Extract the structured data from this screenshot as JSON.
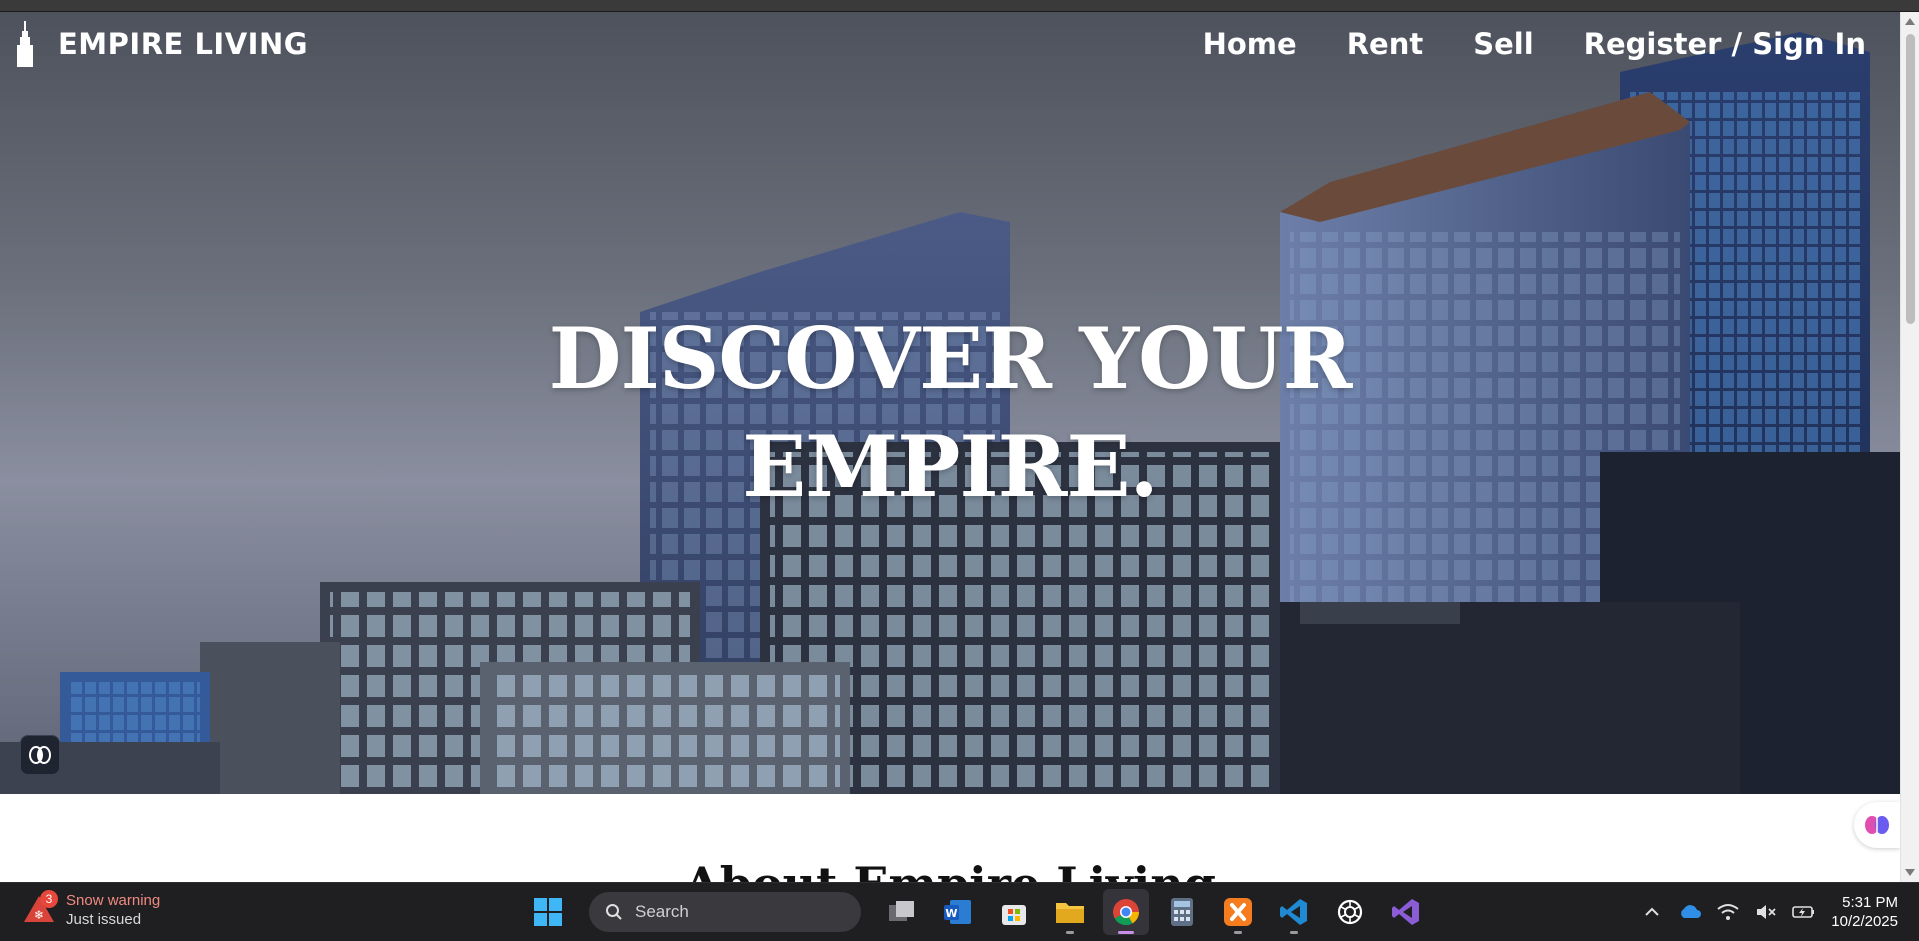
{
  "site": {
    "brand": "EMPIRE LIVING",
    "nav": [
      "Home",
      "Rent",
      "Sell",
      "Register / Sign In"
    ],
    "headline": [
      "DISCOVER YOUR",
      "EMPIRE."
    ],
    "about_title": "About Empire Living"
  },
  "taskbar": {
    "weather": {
      "badge": "3",
      "title": "Snow warning",
      "subtitle": "Just issued"
    },
    "search_placeholder": "Search",
    "apps": [
      "task-view",
      "word",
      "microsoft-store",
      "file-explorer",
      "chrome",
      "calculator",
      "xampp",
      "vscode",
      "chatgpt",
      "visual-studio"
    ],
    "clock": {
      "time": "5:31 PM",
      "date": "10/2/2025"
    }
  },
  "colors": {
    "nav_text": "#ffffff",
    "taskbar_bg": "#1f1f22",
    "weather_alert": "#f08a80"
  }
}
